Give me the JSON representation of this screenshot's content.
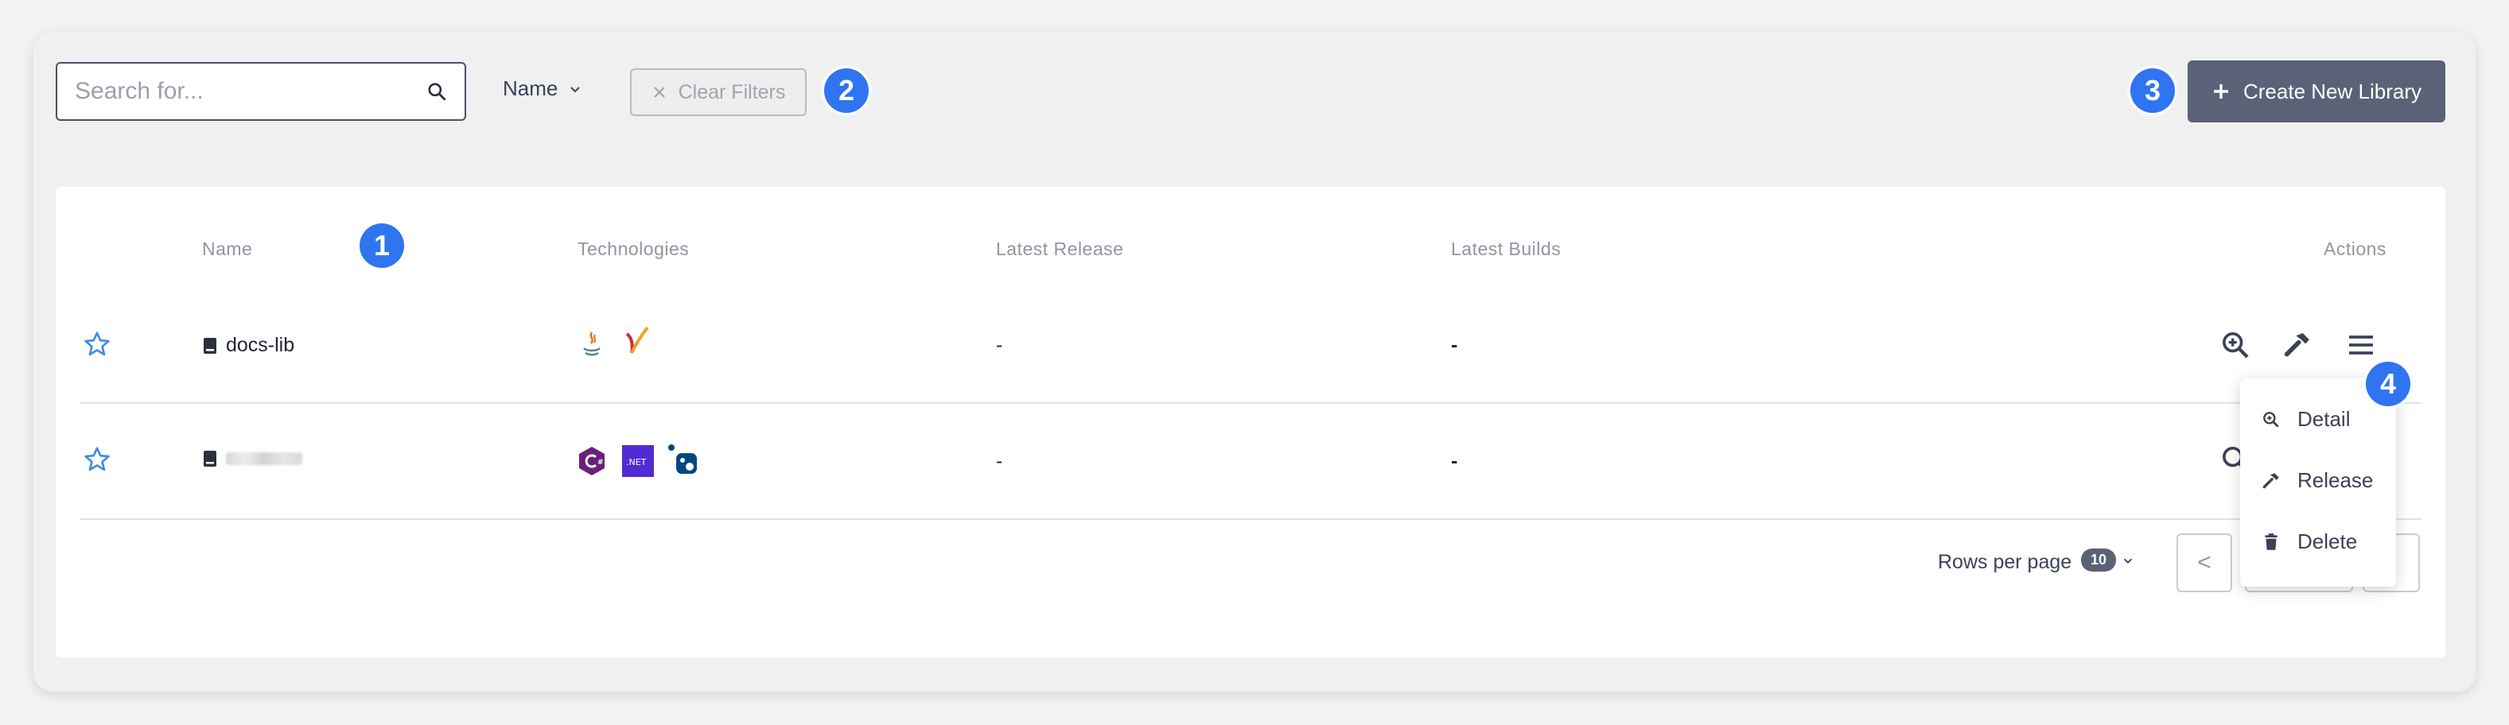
{
  "toolbar": {
    "search_placeholder": "Search for...",
    "name_filter_label": "Name",
    "clear_filters_label": "Clear Filters",
    "create_button_label": "Create New Library"
  },
  "badges": [
    "1",
    "2",
    "3",
    "4"
  ],
  "table": {
    "columns": [
      "Name",
      "Technologies",
      "Latest Release",
      "Latest Builds",
      "Actions"
    ],
    "rows": [
      {
        "name": "docs-lib",
        "technologies": [
          "java-icon",
          "maven-icon"
        ],
        "latest_release": "-",
        "latest_builds": "-"
      },
      {
        "name": "",
        "technologies": [
          "csharp-icon",
          "dotnet-icon",
          "nuget-icon"
        ],
        "latest_release": "-",
        "latest_builds": "-"
      }
    ]
  },
  "pagination": {
    "rows_per_page_label": "Rows per page",
    "rows_per_page_value": "10",
    "prev_label": "<"
  },
  "menu": {
    "items": [
      "Detail",
      "Release",
      "Delete"
    ]
  },
  "colors": {
    "accent": "#2f74f0",
    "primary_button": "#5a6278",
    "star": "#3e8ee0"
  }
}
